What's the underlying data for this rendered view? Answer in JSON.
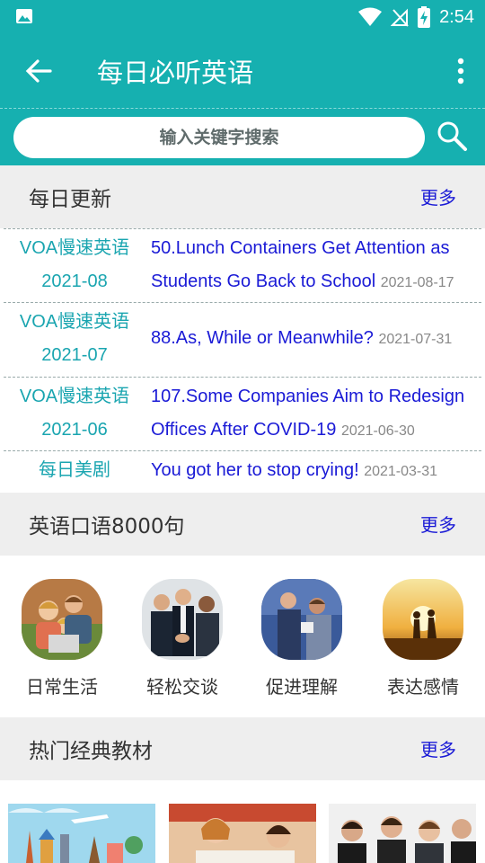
{
  "status_bar": {
    "time": "2:54",
    "icons": [
      "gallery-icon",
      "wifi-icon",
      "no-signal-icon",
      "battery-charging-icon"
    ]
  },
  "app_bar": {
    "title": "每日必听英语",
    "back_icon": "arrow-back-icon",
    "menu_icon": "more-vert-icon"
  },
  "search": {
    "placeholder": "输入关键字搜索",
    "icon": "search-icon"
  },
  "daily_update": {
    "title": "每日更新",
    "more": "更多",
    "items": [
      {
        "cat1": "VOA慢速英语",
        "cat2": "2021-08",
        "line1": "50.Lunch Containers Get Attention as",
        "line2": "Students Go Back to School",
        "date": "2021-08-17"
      },
      {
        "cat1": "VOA慢速英语",
        "cat2": "2021-07",
        "line1": "88.As, While or Meanwhile?",
        "line2": "",
        "date": "2021-07-31"
      },
      {
        "cat1": "VOA慢速英语",
        "cat2": "2021-06",
        "line1": "107.Some Companies Aim to Redesign",
        "line2": "Offices After COVID-19",
        "date": "2021-06-30"
      },
      {
        "cat1": "每日美剧",
        "cat2": "",
        "line1": "You got her to stop crying!",
        "line2": "",
        "date": "2021-03-31"
      }
    ]
  },
  "oral": {
    "title": "英语口语8000句",
    "more": "更多",
    "items": [
      {
        "label": "日常生活",
        "image": "family-photo"
      },
      {
        "label": "轻松交谈",
        "image": "business-handshake-photo"
      },
      {
        "label": "促进理解",
        "image": "office-conversation-photo"
      },
      {
        "label": "表达感情",
        "image": "sunset-couple-photo"
      }
    ]
  },
  "classic": {
    "title": "热门经典教材",
    "more": "更多",
    "items": [
      {
        "image": "travel-landmarks-illustration"
      },
      {
        "image": "students-studying-photo"
      },
      {
        "image": "business-meeting-photo"
      }
    ]
  },
  "colors": {
    "primary": "#16b0b0",
    "link": "#1a1ad6",
    "category": "#1aa5b0",
    "section_bg": "#eeeeee"
  }
}
